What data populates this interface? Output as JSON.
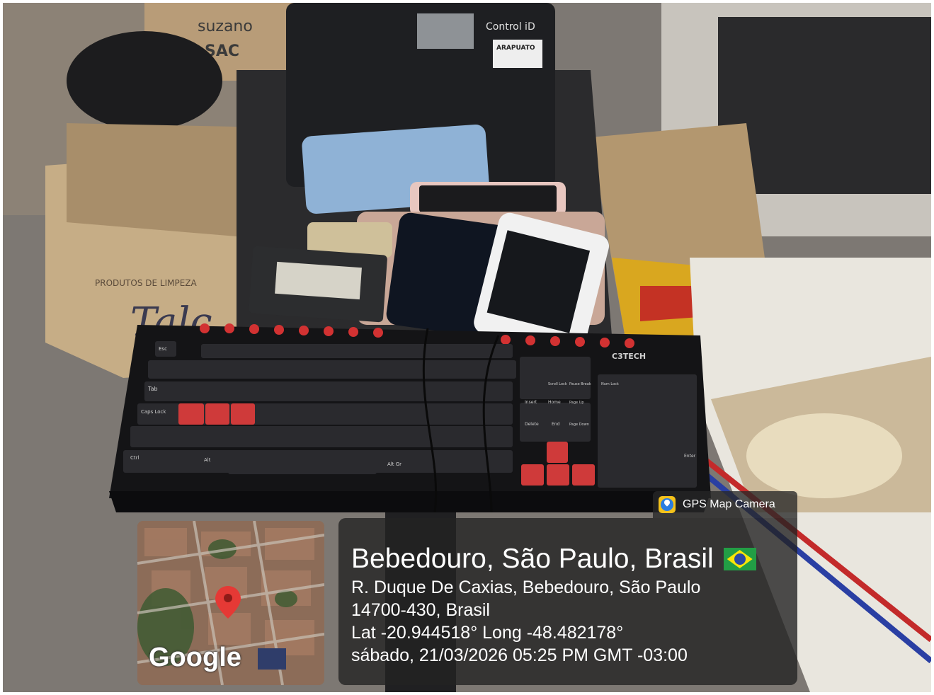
{
  "overlay": {
    "app_label": "GPS Map Camera",
    "app_icon": "gps-map-camera-icon",
    "location_title": "Bebedouro, São Paulo, Brasil",
    "flag_icon": "brazil-flag-icon",
    "address_line1": "R. Duque De Caxias, Bebedouro, São Paulo",
    "address_line2": "14700-430, Brasil",
    "coordinates": "Lat -20.944518° Long -48.482178°",
    "datetime": "sábado, 21/03/2026 05:25 PM GMT -03:00"
  },
  "map": {
    "brand": "Google",
    "pin_icon": "map-pin-icon",
    "pin_color": "#e53935"
  },
  "scene": {
    "box_printed_text": [
      "suzano",
      "SAC",
      "PRODUTOS DE LIMPEZA",
      "Talc"
    ],
    "device_printed_text": [
      "Control iD",
      "ARAPUATO"
    ],
    "keyboard_brand": "C3TECH",
    "keyboard_key_labels": [
      "Esc",
      "Tab",
      "Caps Lock",
      "Ctrl",
      "Alt",
      "Alt Gr",
      "Enter",
      "Home",
      "End",
      "Insert",
      "Delete",
      "Page Up",
      "Page Down",
      "Num Lock",
      "Pause Break",
      "Scroll Lock"
    ]
  }
}
